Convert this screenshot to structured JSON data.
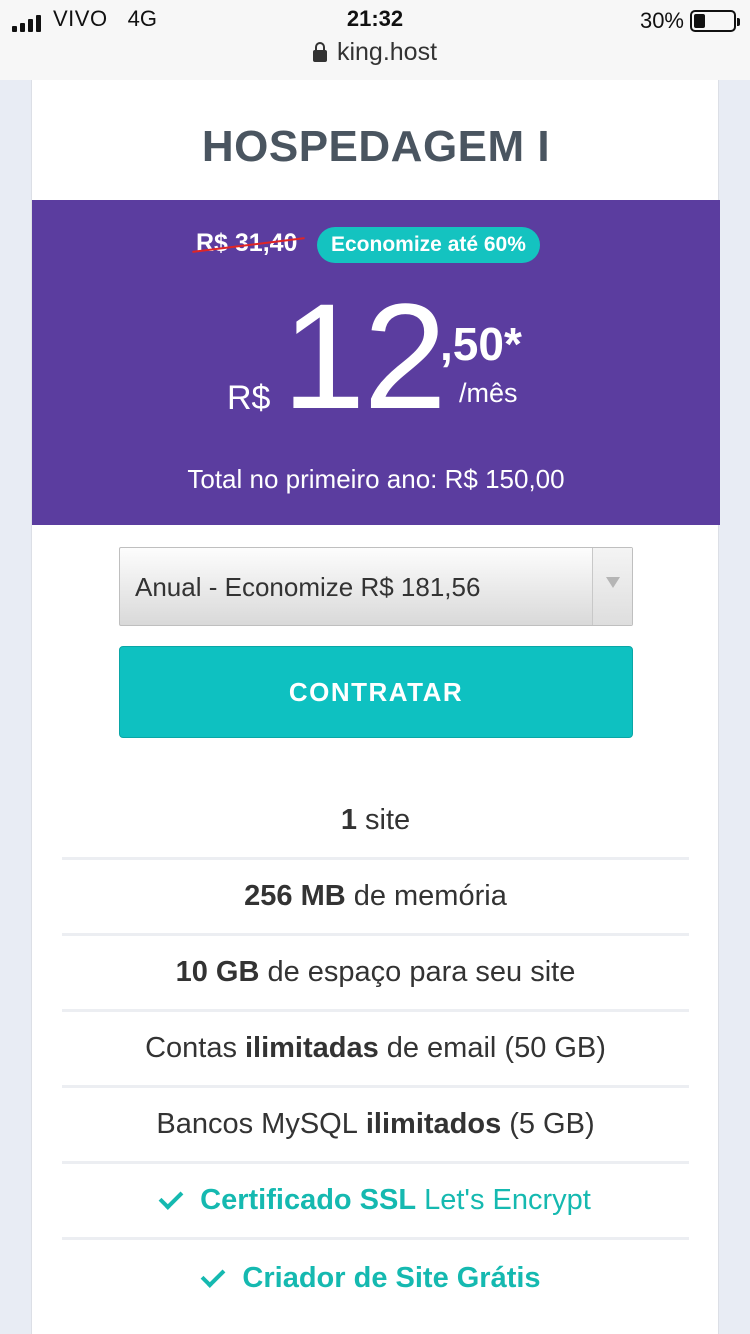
{
  "status_bar": {
    "carrier": "VIVO",
    "network": "4G",
    "time": "21:32",
    "battery_percent": "30%",
    "battery_level": 0.3
  },
  "browser": {
    "url": "king.host"
  },
  "plan": {
    "title": "HOSPEDAGEM I",
    "old_price": "R$ 31,40",
    "savings_badge": "Economize até 60%",
    "currency": "R$",
    "price_integer": "12",
    "price_cents": ",50*",
    "per_month": "/mês",
    "first_year_total": "Total no primeiro ano: R$ 150,00"
  },
  "billing_select": {
    "selected": "Anual - Economize R$ 181,56"
  },
  "cta": {
    "label": "CONTRATAR"
  },
  "features": [
    {
      "bold": "1",
      "after": "site"
    },
    {
      "bold": "256 MB",
      "after": "de memória"
    },
    {
      "bold": "10 GB",
      "after": "de espaço para seu site"
    },
    {
      "before": "Contas",
      "bold": "ilimitadas",
      "after": "de email (50 GB)"
    },
    {
      "before": "Bancos MySQL",
      "bold": "ilimitados",
      "after": "(5 GB)"
    },
    {
      "bold": "Certificado SSL",
      "after": "Let's Encrypt"
    },
    {
      "bold": "Criador de Site Grátis"
    }
  ],
  "colors": {
    "purple": "#5b3d9f",
    "teal": "#0ec1c1",
    "strike_red": "#e02525",
    "title_gray": "#4a5560"
  }
}
